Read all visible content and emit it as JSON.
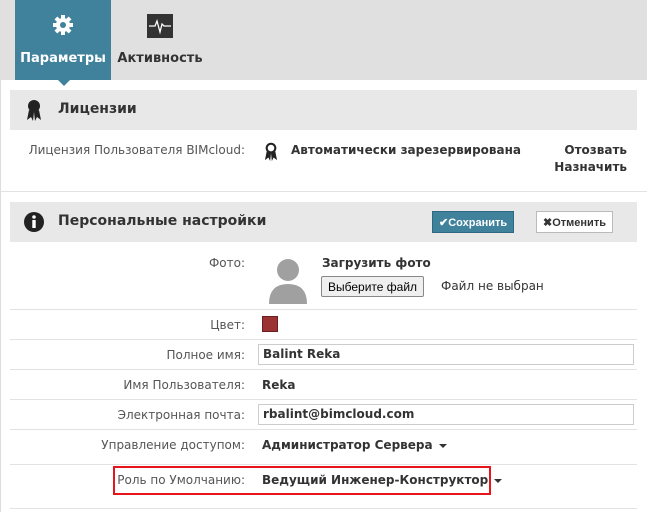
{
  "tabs": [
    {
      "label": "Параметры",
      "icon": "gear-icon",
      "active": true
    },
    {
      "label": "Активность",
      "icon": "activity-icon",
      "active": false
    }
  ],
  "licenses": {
    "title": "Лицензии",
    "row_label": "Лицензия Пользователя BIMcloud:",
    "status": "Автоматически зарезервирована",
    "revoke": "Отозвать",
    "assign": "Назначить"
  },
  "personal": {
    "title": "Персональные настройки",
    "save": "Сохранить",
    "cancel": "Отменить",
    "photo_label": "Фото:",
    "upload_label": "Загрузить фото",
    "choose_file": "Выберите файл",
    "no_file": "Файл не выбран",
    "color_label": "Цвет:",
    "color": "#9b3333",
    "fullname_label": "Полное имя:",
    "fullname": "Balint Reka",
    "username_label": "Имя Пользователя:",
    "username": "Reka",
    "email_label": "Электронная почта:",
    "email": "rbalint@bimcloud.com",
    "access_label": "Управление доступом:",
    "access": "Администратор Сервера",
    "role_label": "Роль по Умолчанию:",
    "role": "Ведущий Инженер-Конструктор"
  },
  "colors": {
    "accent": "#40819c",
    "highlight": "#e8141c"
  }
}
